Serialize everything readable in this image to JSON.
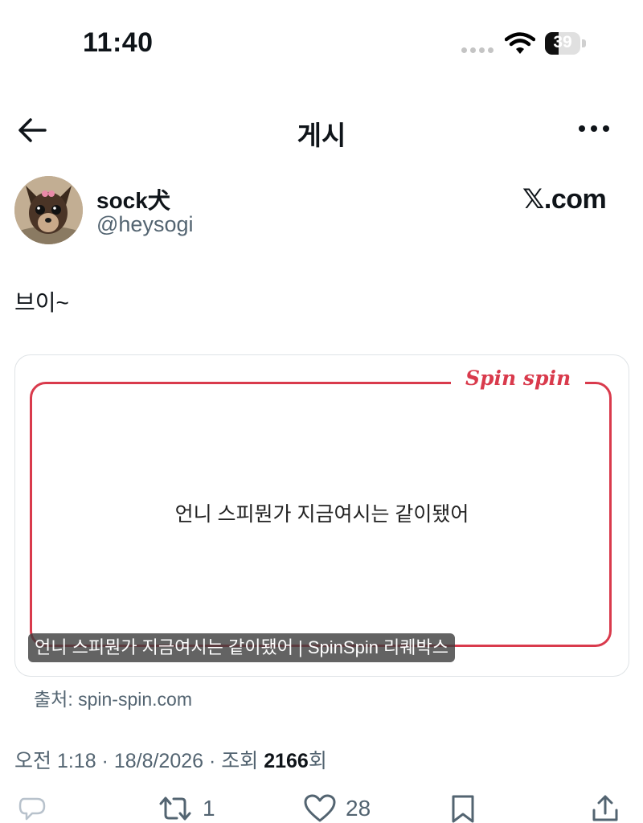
{
  "status_bar": {
    "time": "11:40",
    "battery_level": "39",
    "battery_fraction": 0.39
  },
  "nav": {
    "title": "게시"
  },
  "author": {
    "display_name": "sock犬",
    "handle": "@heysogi",
    "watermark": "𝕏.com"
  },
  "post": {
    "text": "브이~"
  },
  "link_card": {
    "brand": "Spin spin",
    "main_text": "언니 스피뭔가 지금여시는 같이됐어",
    "caption": "언니 스피뭔가 지금여시는 같이됐어 | SpinSpin 리퀘박스",
    "source": "출처: spin-spin.com"
  },
  "meta": {
    "time_date": "오전 1:18 · 18/8/2026 · 조회 ",
    "views": "2166",
    "views_suffix": "회"
  },
  "actions": {
    "retweet_count": "1",
    "like_count": "28"
  },
  "colors": {
    "brand_red": "#d93a4c",
    "secondary_text": "#536471",
    "primary_text": "#0f1419"
  }
}
